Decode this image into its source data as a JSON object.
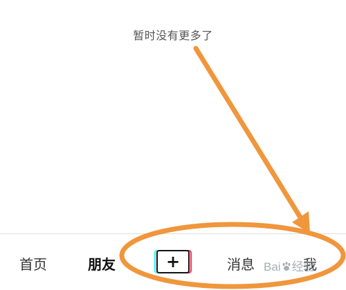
{
  "content": {
    "empty_message": "暂时没有更多了"
  },
  "tabbar": {
    "home_label": "首页",
    "friends_label": "朋友",
    "add_label": "+",
    "messages_label": "消息",
    "me_label": "我"
  },
  "watermark": {
    "text_left": "Bai",
    "text_right": "经验"
  },
  "colors": {
    "annotation": "#f0963c",
    "add_cyan": "#25f4ee",
    "add_red": "#fe2c55"
  },
  "icons": {
    "add": "plus-icon",
    "watermark": "paw-icon"
  }
}
